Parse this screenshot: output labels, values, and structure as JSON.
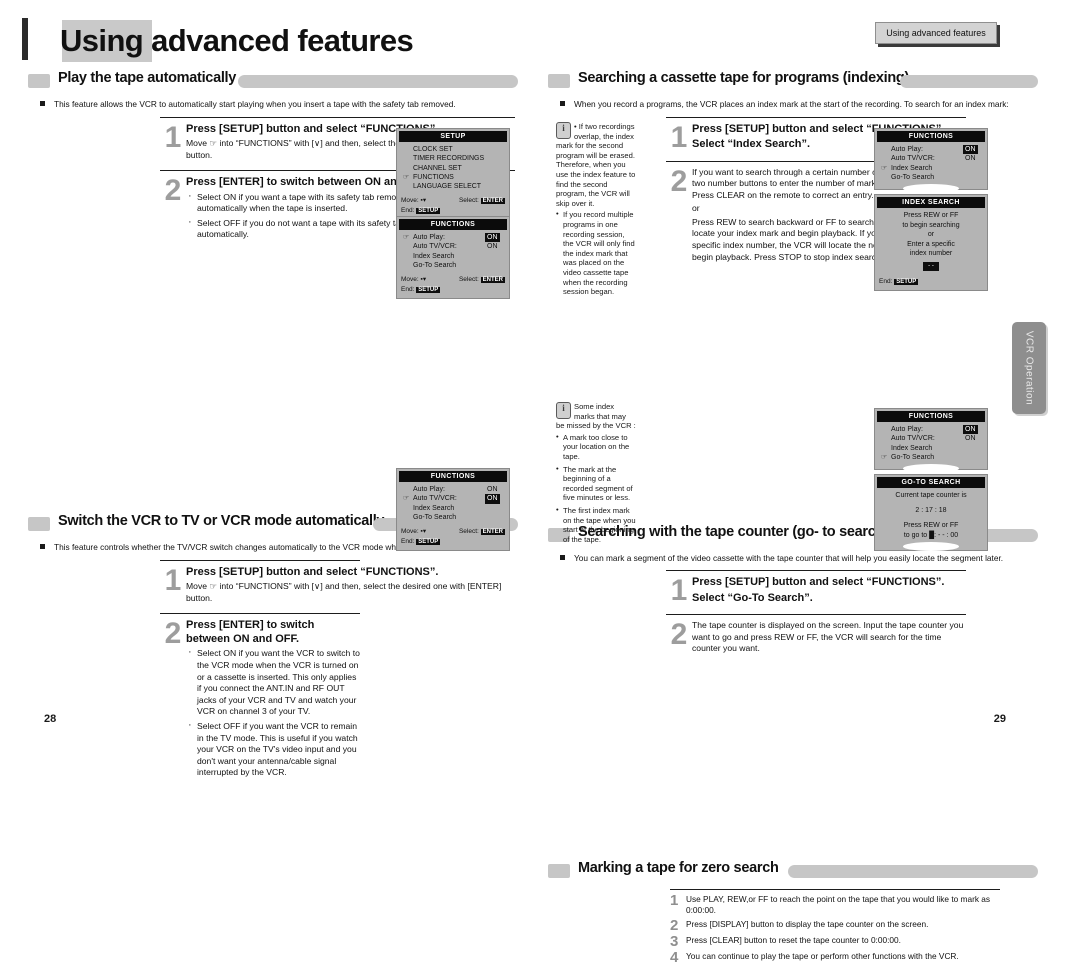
{
  "document": {
    "title": "Using advanced features",
    "header_tab": "Using advanced features",
    "side_tab": "VCR Operation",
    "page_left": "28",
    "page_right": "29"
  },
  "sections": {
    "play_auto": {
      "title": "Play the tape automatically",
      "intro": "This feature allows the VCR to automatically start playing when you insert a tape with the safety tab removed.",
      "step1": {
        "num": "1",
        "heading": "Press [SETUP] button and select “FUNCTIONS”.",
        "body": "Move ☞ into “FUNCTIONS” with [∨] and then, select the desired one with [ENTER] button."
      },
      "step2": {
        "num": "2",
        "heading": "Press [ENTER] to switch between ON and OFF.",
        "bullets": [
          "Select ON if you want a tape with its safety tab removed to start playing automatically when the tape is inserted.",
          "Select OFF if you do not want a tape with its safety tab removed to start playing automatically."
        ]
      },
      "osd_setup": {
        "title": "SETUP",
        "items": [
          {
            "label": "CLOCK SET",
            "pointer": false
          },
          {
            "label": "TIMER RECORDINGS",
            "pointer": false
          },
          {
            "label": "CHANNEL SET",
            "pointer": false
          },
          {
            "label": "FUNCTIONS",
            "pointer": true
          },
          {
            "label": "LANGUAGE SELECT",
            "pointer": false
          }
        ],
        "foot_move": "Move:",
        "foot_select": "Select:",
        "foot_select_key": "ENTER",
        "foot_end": "End:",
        "foot_end_key": "SETUP"
      },
      "osd_functions": {
        "title": "FUNCTIONS",
        "items": [
          {
            "label": "Auto Play:",
            "value": "ON",
            "highlight": true,
            "pointer": true
          },
          {
            "label": "Auto TV/VCR:",
            "value": "ON",
            "highlight": false,
            "pointer": false
          },
          {
            "label": "Index Search",
            "value": "",
            "highlight": false,
            "pointer": false
          },
          {
            "label": "Go-To Search",
            "value": "",
            "highlight": false,
            "pointer": false
          }
        ],
        "foot_move": "Move:",
        "foot_select": "Select:",
        "foot_select_key": "ENTER",
        "foot_end": "End:",
        "foot_end_key": "SETUP"
      }
    },
    "switch_mode": {
      "title": "Switch the VCR to TV or VCR mode automatically",
      "intro": "This feature controls whether the TV/VCR switch changes automatically to the VCR mode when the VCR is turned on.",
      "step1": {
        "num": "1",
        "heading": "Press [SETUP] button and select “FUNCTIONS”.",
        "body": "Move ☞ into “FUNCTIONS” with [∨] and then, select the desired one with [ENTER] button."
      },
      "step2": {
        "num": "2",
        "heading": "Press [ENTER]  to switch between ON and OFF.",
        "bullets": [
          "Select ON if you want the VCR to switch to the VCR mode when the VCR is turned on or a cassette is inserted. This only applies if you connect the ANT.IN and RF OUT jacks of your VCR and TV and watch  your VCR on channel 3 of your TV.",
          "Select OFF if you want the VCR to remain in the TV mode. This is useful if you watch your VCR on the TV's video input and you don't want your antenna/cable signal interrupted by the VCR."
        ]
      },
      "osd_functions": {
        "title": "FUNCTIONS",
        "items": [
          {
            "label": "Auto Play:",
            "value": "ON",
            "highlight": false,
            "pointer": false
          },
          {
            "label": "Auto TV/VCR:",
            "value": "ON",
            "highlight": true,
            "pointer": true
          },
          {
            "label": "Index Search",
            "value": "",
            "highlight": false,
            "pointer": false
          },
          {
            "label": "Go-To Search",
            "value": "",
            "highlight": false,
            "pointer": false
          }
        ],
        "foot_move": "Move:",
        "foot_select": "Select:",
        "foot_select_key": "ENTER",
        "foot_end": "End:",
        "foot_end_key": "SETUP"
      }
    },
    "indexing": {
      "title": "Searching a cassette tape for programs (indexing)",
      "intro": "When you record a programs, the VCR places an index mark at the start of the recording. To search for an index mark:",
      "note": {
        "first": "If two recordings overlap, the index mark for the second program will be erased. Therefore, when you use the index feature to find the second program, the VCR will skip over it.",
        "bullets": [
          "If you record multiple programs in one recording session, the VCR will only find the index mark that was placed on the video cassette tape when the recording session began."
        ]
      },
      "step1": {
        "num": "1",
        "heading": "Press [SETUP] button and select “FUNCTIONS”.",
        "heading2": "Select “Index Search”."
      },
      "step2": {
        "num": "2",
        "p1": "If you want to search through a certain number of index marks, press two number buttons to enter the number of marks you want to search. Press CLEAR on the remote to correct an entry.",
        "p2": "or",
        "p3": "Press REW to search backward or FF to search forward. The VCR will locate your index mark and begin playback. If you did not enter a specific index number, the VCR will locate the next index mark and begin playback. Press STOP to stop index searching."
      },
      "osd_functions": {
        "title": "FUNCTIONS",
        "items": [
          {
            "label": "Auto Play:",
            "value": "ON",
            "highlight": true,
            "pointer": false
          },
          {
            "label": "Auto TV/VCR:",
            "value": "ON",
            "highlight": false,
            "pointer": false
          },
          {
            "label": "Index Search",
            "value": "",
            "highlight": false,
            "pointer": true
          },
          {
            "label": "Go-To Search",
            "value": "",
            "highlight": false,
            "pointer": false
          }
        ]
      },
      "osd_index": {
        "title": "INDEX SEARCH",
        "lines": [
          "Press REW or FF",
          "to begin searching",
          "or",
          "Enter a specific",
          "index number"
        ],
        "box": "- -",
        "foot_end": "End:",
        "foot_end_key": "SETUP"
      }
    },
    "go_to_search": {
      "title": "Searching with the tape counter (go- to search)",
      "intro": "You can mark a segment of the video cassette with the tape counter that will help you easily locate the segment later.",
      "note": {
        "first": "Some index marks  that may be missed by the VCR :",
        "bullets": [
          "A mark too close to your location on the tape.",
          "The mark at the beginning of a recorded segment of five minutes or less.",
          "The first index mark on the tape when you start at the beginning of the tape."
        ]
      },
      "step1": {
        "num": "1",
        "heading": "Press [SETUP] button and select “FUNCTIONS”.",
        "heading2": "Select “Go-To Search”."
      },
      "step2": {
        "num": "2",
        "p1": "The tape counter is displayed on the screen. Input the tape counter you want to go and press REW or FF, the VCR will search for the time counter you want."
      },
      "osd_functions": {
        "title": "FUNCTIONS",
        "items": [
          {
            "label": "Auto Play:",
            "value": "ON",
            "highlight": true,
            "pointer": false
          },
          {
            "label": "Auto TV/VCR:",
            "value": "ON",
            "highlight": false,
            "pointer": false
          },
          {
            "label": "Index Search",
            "value": "",
            "highlight": false,
            "pointer": false
          },
          {
            "label": "Go-To Search",
            "value": "",
            "highlight": false,
            "pointer": true
          }
        ]
      },
      "osd_goto": {
        "title": "GO-TO SEARCH",
        "line1": "Current tape counter is",
        "counter": "2 : 17 : 18",
        "line2": "Press REW or FF",
        "line3": "to go to █: - - : 00"
      }
    },
    "zero_search": {
      "title": "Marking a tape for zero search",
      "items": [
        {
          "num": "1",
          "text": "Use PLAY, REW,or FF to reach the point on the tape that you would like to mark as 0:00:00."
        },
        {
          "num": "2",
          "text": "Press [DISPLAY] button to display  the tape counter on the screen."
        },
        {
          "num": "3",
          "text": "Press [CLEAR] button to reset the tape counter to 0:00:00."
        },
        {
          "num": "4",
          "text": "You can continue to play the tape or perform other functions with the VCR."
        }
      ]
    }
  }
}
